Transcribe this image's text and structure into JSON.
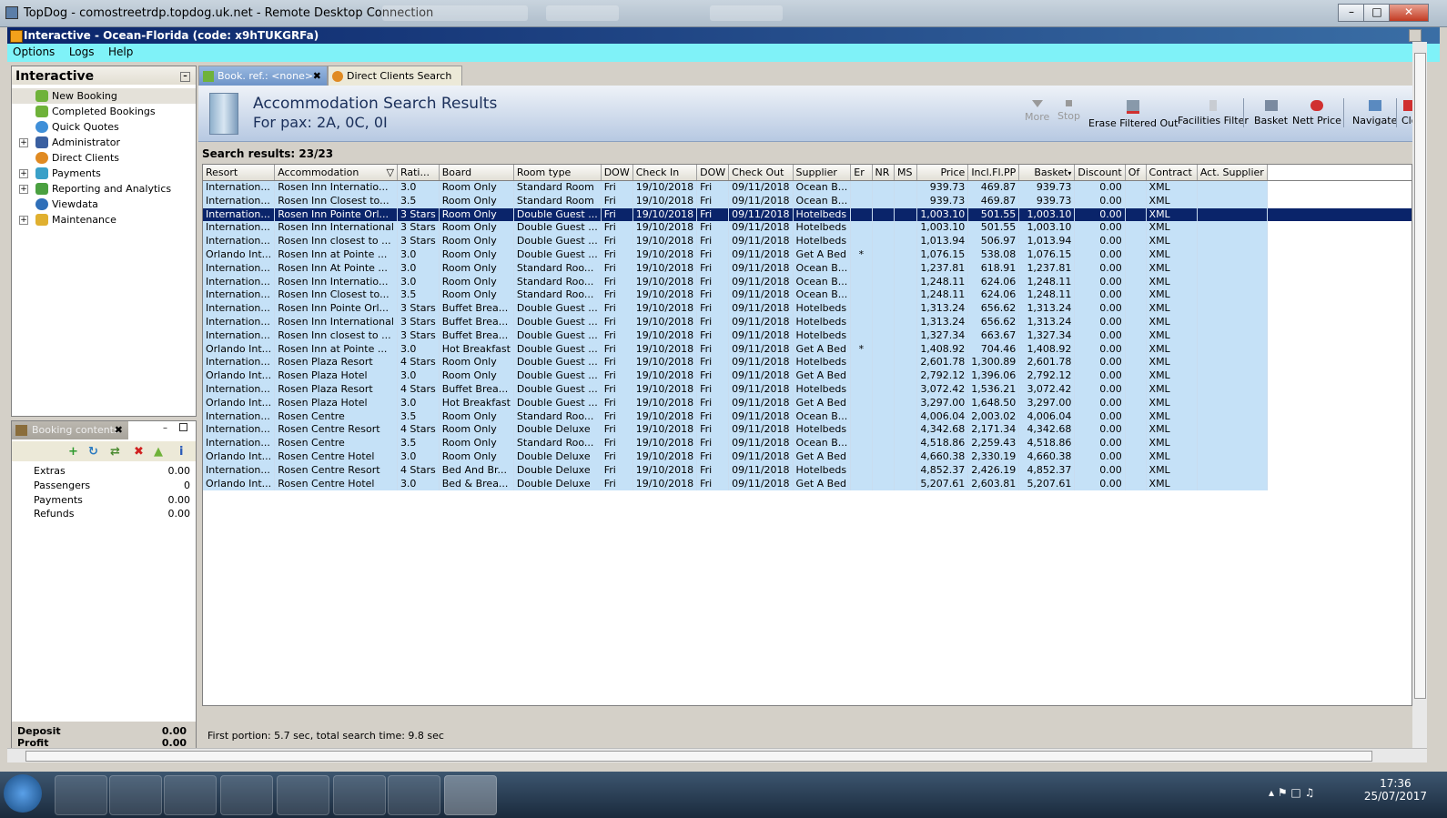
{
  "rdp": {
    "title": "TopDog - comostreetrdp.topdog.uk.net - Remote Desktop Connection"
  },
  "app": {
    "title": "Interactive - Ocean-Florida (code: x9hTUKGRFa)"
  },
  "menu": [
    "Options",
    "Logs",
    "Help"
  ],
  "sidebar": {
    "header": "Interactive",
    "items": [
      {
        "label": "New Booking",
        "icon": "palm-tree-icon"
      },
      {
        "label": "Completed Bookings",
        "icon": "palm-tree-icon"
      },
      {
        "label": "Quick Quotes",
        "icon": "clock-icon"
      },
      {
        "label": "Administrator",
        "icon": "person-icon"
      },
      {
        "label": "Direct Clients",
        "icon": "sun-icon"
      },
      {
        "label": "Payments",
        "icon": "payments-icon"
      },
      {
        "label": "Reporting and Analytics",
        "icon": "report-icon"
      },
      {
        "label": "Viewdata",
        "icon": "globe-icon"
      },
      {
        "label": "Maintenance",
        "icon": "maintenance-icon"
      }
    ]
  },
  "booking_contents": {
    "tab_label": "Booking contents",
    "rows": [
      {
        "label": "Extras",
        "value": "0.00"
      },
      {
        "label": "Passengers",
        "value": "0"
      },
      {
        "label": "Payments",
        "value": "0.00"
      },
      {
        "label": "Refunds",
        "value": "0.00"
      }
    ],
    "deposit_label": "Deposit",
    "deposit_value": "0.00",
    "profit_label": "Profit",
    "profit_value": "0.00"
  },
  "tabs": [
    {
      "label": "Book. ref.: <none>"
    },
    {
      "label": "Direct Clients Search"
    }
  ],
  "results": {
    "title": "Accommodation Search Results",
    "subtitle": "For pax: 2A, 0C, 0I",
    "count_text": "Search results: 23/23",
    "status_text": "First portion: 5.7 sec, total search time: 9.8 sec"
  },
  "toolbar": [
    {
      "label": "More",
      "disabled": true
    },
    {
      "label": "Stop",
      "disabled": true
    },
    {
      "label": "Erase Filtered Out",
      "disabled": false
    },
    {
      "label": "Facilities Filter",
      "disabled": false
    },
    {
      "label": "Basket",
      "disabled": false
    },
    {
      "label": "Nett Price",
      "disabled": false
    },
    {
      "label": "Navigate",
      "disabled": false
    },
    {
      "label": "Clo",
      "disabled": false
    }
  ],
  "columns": [
    "Resort",
    "Accommodation",
    "Rati...",
    "Board",
    "Room type",
    "DOW",
    "Check In",
    "DOW",
    "Check Out",
    "Supplier",
    "Er",
    "NR",
    "MS",
    "Price",
    "Incl.Fl.PP",
    "Basket",
    "Discount",
    "Of",
    "Contract",
    "Act. Supplier"
  ],
  "rows": [
    [
      "Internation...",
      "Rosen Inn Internatio...",
      "3.0",
      "Room Only",
      "Standard Room",
      "Fri",
      "19/10/2018",
      "Fri",
      "09/11/2018",
      "Ocean B...",
      "",
      "",
      "",
      "939.73",
      "469.87",
      "939.73",
      "0.00",
      "",
      "XML",
      ""
    ],
    [
      "Internation...",
      "Rosen Inn Closest to...",
      "3.5",
      "Room Only",
      "Standard Room",
      "Fri",
      "19/10/2018",
      "Fri",
      "09/11/2018",
      "Ocean B...",
      "",
      "",
      "",
      "939.73",
      "469.87",
      "939.73",
      "0.00",
      "",
      "XML",
      ""
    ],
    [
      "Internation...",
      "Rosen Inn Pointe Orl...",
      "3 Stars",
      "Room Only",
      "Double Guest ...",
      "Fri",
      "19/10/2018",
      "Fri",
      "09/11/2018",
      "Hotelbeds",
      "",
      "",
      "",
      "1,003.10",
      "501.55",
      "1,003.10",
      "0.00",
      "",
      "XML",
      ""
    ],
    [
      "Internation...",
      "Rosen Inn International",
      "3 Stars",
      "Room Only",
      "Double Guest ...",
      "Fri",
      "19/10/2018",
      "Fri",
      "09/11/2018",
      "Hotelbeds",
      "",
      "",
      "",
      "1,003.10",
      "501.55",
      "1,003.10",
      "0.00",
      "",
      "XML",
      ""
    ],
    [
      "Internation...",
      "Rosen Inn closest to ...",
      "3 Stars",
      "Room Only",
      "Double Guest ...",
      "Fri",
      "19/10/2018",
      "Fri",
      "09/11/2018",
      "Hotelbeds",
      "",
      "",
      "",
      "1,013.94",
      "506.97",
      "1,013.94",
      "0.00",
      "",
      "XML",
      ""
    ],
    [
      "Orlando Int...",
      "Rosen Inn at Pointe ...",
      "3.0",
      "Room Only",
      "Double Guest ...",
      "Fri",
      "19/10/2018",
      "Fri",
      "09/11/2018",
      "Get A Bed",
      "*",
      "",
      "",
      "1,076.15",
      "538.08",
      "1,076.15",
      "0.00",
      "",
      "XML",
      ""
    ],
    [
      "Internation...",
      "Rosen Inn At Pointe ...",
      "3.0",
      "Room Only",
      "Standard Roo...",
      "Fri",
      "19/10/2018",
      "Fri",
      "09/11/2018",
      "Ocean B...",
      "",
      "",
      "",
      "1,237.81",
      "618.91",
      "1,237.81",
      "0.00",
      "",
      "XML",
      ""
    ],
    [
      "Internation...",
      "Rosen Inn Internatio...",
      "3.0",
      "Room Only",
      "Standard Roo...",
      "Fri",
      "19/10/2018",
      "Fri",
      "09/11/2018",
      "Ocean B...",
      "",
      "",
      "",
      "1,248.11",
      "624.06",
      "1,248.11",
      "0.00",
      "",
      "XML",
      ""
    ],
    [
      "Internation...",
      "Rosen Inn Closest to...",
      "3.5",
      "Room Only",
      "Standard Roo...",
      "Fri",
      "19/10/2018",
      "Fri",
      "09/11/2018",
      "Ocean B...",
      "",
      "",
      "",
      "1,248.11",
      "624.06",
      "1,248.11",
      "0.00",
      "",
      "XML",
      ""
    ],
    [
      "Internation...",
      "Rosen Inn Pointe Orl...",
      "3 Stars",
      "Buffet Brea...",
      "Double Guest ...",
      "Fri",
      "19/10/2018",
      "Fri",
      "09/11/2018",
      "Hotelbeds",
      "",
      "",
      "",
      "1,313.24",
      "656.62",
      "1,313.24",
      "0.00",
      "",
      "XML",
      ""
    ],
    [
      "Internation...",
      "Rosen Inn International",
      "3 Stars",
      "Buffet Brea...",
      "Double Guest ...",
      "Fri",
      "19/10/2018",
      "Fri",
      "09/11/2018",
      "Hotelbeds",
      "",
      "",
      "",
      "1,313.24",
      "656.62",
      "1,313.24",
      "0.00",
      "",
      "XML",
      ""
    ],
    [
      "Internation...",
      "Rosen Inn closest to ...",
      "3 Stars",
      "Buffet Brea...",
      "Double Guest ...",
      "Fri",
      "19/10/2018",
      "Fri",
      "09/11/2018",
      "Hotelbeds",
      "",
      "",
      "",
      "1,327.34",
      "663.67",
      "1,327.34",
      "0.00",
      "",
      "XML",
      ""
    ],
    [
      "Orlando Int...",
      "Rosen Inn at Pointe ...",
      "3.0",
      "Hot Breakfast",
      "Double Guest ...",
      "Fri",
      "19/10/2018",
      "Fri",
      "09/11/2018",
      "Get A Bed",
      "*",
      "",
      "",
      "1,408.92",
      "704.46",
      "1,408.92",
      "0.00",
      "",
      "XML",
      ""
    ],
    [
      "Internation...",
      "Rosen Plaza Resort",
      "4 Stars",
      "Room Only",
      "Double Guest ...",
      "Fri",
      "19/10/2018",
      "Fri",
      "09/11/2018",
      "Hotelbeds",
      "",
      "",
      "",
      "2,601.78",
      "1,300.89",
      "2,601.78",
      "0.00",
      "",
      "XML",
      ""
    ],
    [
      "Orlando Int...",
      "Rosen Plaza Hotel",
      "3.0",
      "Room Only",
      "Double Guest ...",
      "Fri",
      "19/10/2018",
      "Fri",
      "09/11/2018",
      "Get A Bed",
      "",
      "",
      "",
      "2,792.12",
      "1,396.06",
      "2,792.12",
      "0.00",
      "",
      "XML",
      ""
    ],
    [
      "Internation...",
      "Rosen Plaza Resort",
      "4 Stars",
      "Buffet Brea...",
      "Double Guest ...",
      "Fri",
      "19/10/2018",
      "Fri",
      "09/11/2018",
      "Hotelbeds",
      "",
      "",
      "",
      "3,072.42",
      "1,536.21",
      "3,072.42",
      "0.00",
      "",
      "XML",
      ""
    ],
    [
      "Orlando Int...",
      "Rosen Plaza Hotel",
      "3.0",
      "Hot Breakfast",
      "Double Guest ...",
      "Fri",
      "19/10/2018",
      "Fri",
      "09/11/2018",
      "Get A Bed",
      "",
      "",
      "",
      "3,297.00",
      "1,648.50",
      "3,297.00",
      "0.00",
      "",
      "XML",
      ""
    ],
    [
      "Internation...",
      "Rosen Centre",
      "3.5",
      "Room Only",
      "Standard Roo...",
      "Fri",
      "19/10/2018",
      "Fri",
      "09/11/2018",
      "Ocean B...",
      "",
      "",
      "",
      "4,006.04",
      "2,003.02",
      "4,006.04",
      "0.00",
      "",
      "XML",
      ""
    ],
    [
      "Internation...",
      "Rosen Centre Resort",
      "4 Stars",
      "Room Only",
      "Double Deluxe",
      "Fri",
      "19/10/2018",
      "Fri",
      "09/11/2018",
      "Hotelbeds",
      "",
      "",
      "",
      "4,342.68",
      "2,171.34",
      "4,342.68",
      "0.00",
      "",
      "XML",
      ""
    ],
    [
      "Internation...",
      "Rosen Centre",
      "3.5",
      "Room Only",
      "Standard Roo...",
      "Fri",
      "19/10/2018",
      "Fri",
      "09/11/2018",
      "Ocean B...",
      "",
      "",
      "",
      "4,518.86",
      "2,259.43",
      "4,518.86",
      "0.00",
      "",
      "XML",
      ""
    ],
    [
      "Orlando Int...",
      "Rosen Centre Hotel",
      "3.0",
      "Room Only",
      "Double Deluxe",
      "Fri",
      "19/10/2018",
      "Fri",
      "09/11/2018",
      "Get A Bed",
      "",
      "",
      "",
      "4,660.38",
      "2,330.19",
      "4,660.38",
      "0.00",
      "",
      "XML",
      ""
    ],
    [
      "Internation...",
      "Rosen Centre Resort",
      "4 Stars",
      "Bed And Br...",
      "Double Deluxe",
      "Fri",
      "19/10/2018",
      "Fri",
      "09/11/2018",
      "Hotelbeds",
      "",
      "",
      "",
      "4,852.37",
      "2,426.19",
      "4,852.37",
      "0.00",
      "",
      "XML",
      ""
    ],
    [
      "Orlando Int...",
      "Rosen Centre Hotel",
      "3.0",
      "Bed & Brea...",
      "Double Deluxe",
      "Fri",
      "19/10/2018",
      "Fri",
      "09/11/2018",
      "Get A Bed",
      "",
      "",
      "",
      "5,207.61",
      "2,603.81",
      "5,207.61",
      "0.00",
      "",
      "XML",
      ""
    ]
  ],
  "selected_row_index": 2,
  "taskbar": {
    "clock_time": "17:36",
    "clock_date": "25/07/2017"
  },
  "colors": {
    "grid_row": "#c5e1f7",
    "selected_row": "#0a246a",
    "menubar": "#7ff2f8",
    "app_title": "#0a246a"
  }
}
